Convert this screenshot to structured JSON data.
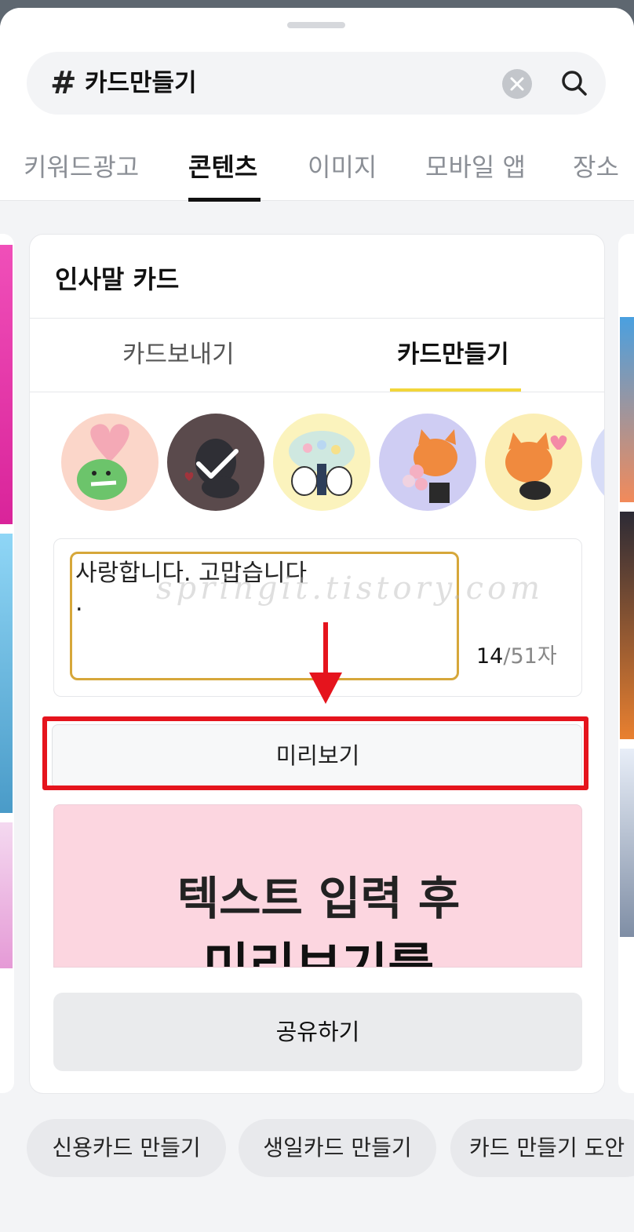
{
  "search": {
    "hash": "#",
    "query": "카드만들기"
  },
  "tabs": [
    "키워드광고",
    "콘텐츠",
    "이미지",
    "모바일 앱",
    "장소"
  ],
  "active_tab": "콘텐츠",
  "card": {
    "title": "인사말 카드",
    "subtabs": [
      "카드보내기",
      "카드만들기"
    ],
    "active_subtab": "카드만들기",
    "text_value": "사랑합니다. 고맙습니다\n.",
    "watermark": "springit.tistory.com",
    "counter_current": "14",
    "counter_max": "/51자",
    "preview_button": "미리보기",
    "preview_line1": "텍스트 입력 후",
    "preview_line2": "미리보기를",
    "share_button": "공유하기"
  },
  "colors": {
    "highlight": "#e5141d",
    "subtab_underline": "#f2d63a",
    "textarea_border": "#d6a73a",
    "preview_bg": "#fcd6e0"
  },
  "related": [
    "신용카드 만들기",
    "생일카드 만들기",
    "카드 만들기 도안"
  ]
}
